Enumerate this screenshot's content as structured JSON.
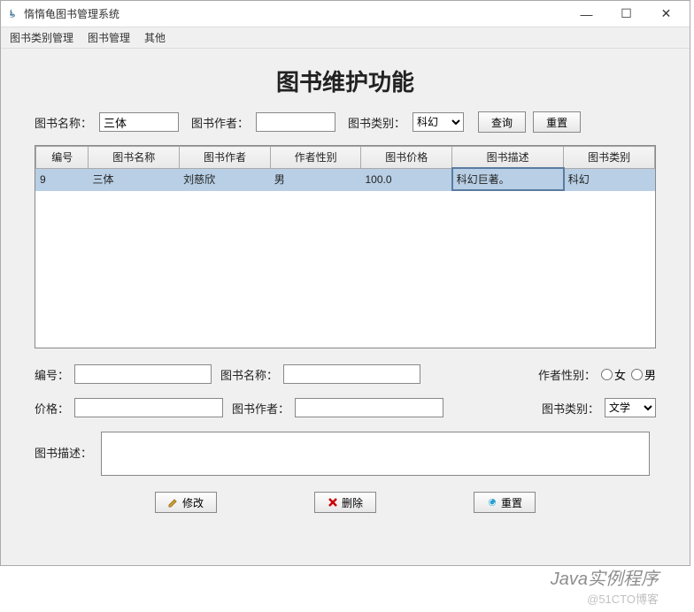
{
  "window": {
    "title": "惰惰龟图书管理系统",
    "minimize": "—",
    "maximize": "☐",
    "close": "✕"
  },
  "menubar": {
    "category_mgmt": "图书类别管理",
    "book_mgmt": "图书管理",
    "other": "其他"
  },
  "heading": "图书维护功能",
  "search": {
    "name_label": "图书名称：",
    "name_value": "三体",
    "author_label": "图书作者：",
    "author_value": "",
    "category_label": "图书类别：",
    "category_value": "科幻",
    "query_btn": "查询",
    "reset_btn": "重置"
  },
  "table": {
    "headers": [
      "编号",
      "图书名称",
      "图书作者",
      "作者性别",
      "图书价格",
      "图书描述",
      "图书类别"
    ],
    "rows": [
      {
        "id": "9",
        "name": "三体",
        "author": "刘慈欣",
        "sex": "男",
        "price": "100.0",
        "desc": "科幻巨著。",
        "category": "科幻"
      }
    ]
  },
  "form": {
    "id_label": "编号：",
    "id_value": "",
    "name_label": "图书名称：",
    "name_value": "",
    "sex_label": "作者性别：",
    "sex_female": "女",
    "sex_male": "男",
    "price_label": "价格：",
    "price_value": "",
    "author_label": "图书作者：",
    "author_value": "",
    "category_label": "图书类别：",
    "category_value": "文学",
    "desc_label": "图书描述：",
    "desc_value": ""
  },
  "actions": {
    "modify": "修改",
    "delete": "删除",
    "reset": "重置"
  },
  "watermark": {
    "line1": "Java实例程序",
    "line2": "@51CTO博客"
  }
}
